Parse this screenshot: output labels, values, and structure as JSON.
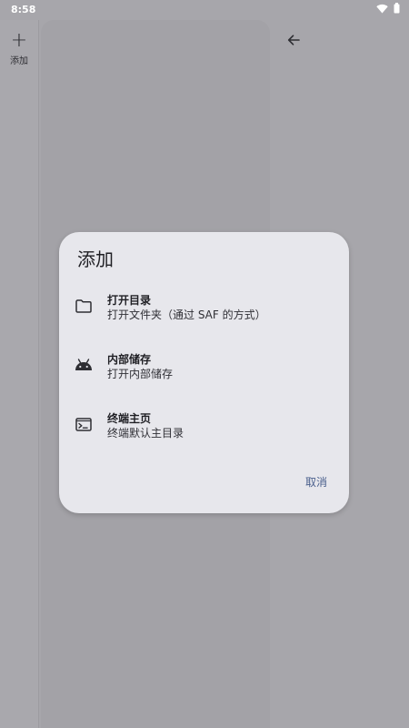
{
  "status_bar": {
    "time": "8:58",
    "icons": [
      "wifi-icon",
      "battery-icon"
    ]
  },
  "nav_rail": {
    "add_label": "添加"
  },
  "dialog": {
    "title": "添加",
    "items": [
      {
        "icon": "folder-icon",
        "title": "打开目录",
        "subtitle": "打开文件夹（通过 SAF 的方式）"
      },
      {
        "icon": "android-icon",
        "title": "内部储存",
        "subtitle": "打开内部储存"
      },
      {
        "icon": "terminal-icon",
        "title": "终端主页",
        "subtitle": "终端默认主目录"
      }
    ],
    "cancel_label": "取消"
  },
  "colors": {
    "scrim": "#a7a6ab",
    "dialog_bg": "#e7e7ec",
    "accent": "#4a5f8c",
    "text": "#1f1f24"
  }
}
